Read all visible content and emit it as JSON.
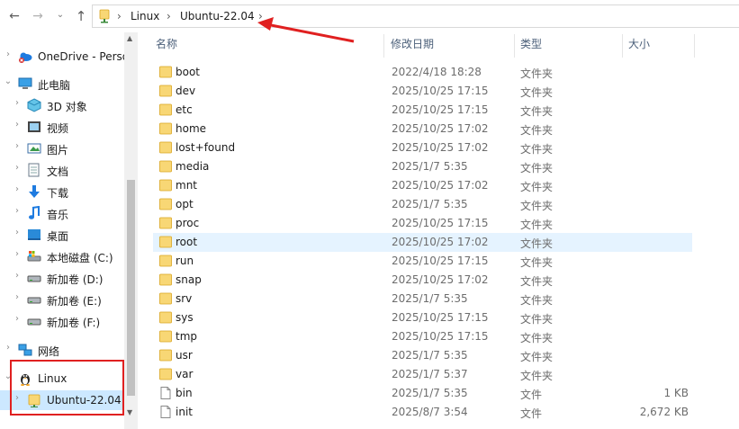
{
  "address_bar": {
    "breadcrumbs": [
      "Linux",
      "Ubuntu-22.04"
    ]
  },
  "nav_pane": {
    "items": [
      {
        "label": "OneDrive - Perso",
        "icon": "onedrive-icon",
        "level": 0,
        "chevron": "right"
      },
      {
        "label": "此电脑",
        "icon": "this-pc-icon",
        "level": 0,
        "chevron": "down"
      },
      {
        "label": "3D 对象",
        "icon": "3d-objects-icon",
        "level": 1,
        "chevron": "right"
      },
      {
        "label": "视频",
        "icon": "videos-icon",
        "level": 1,
        "chevron": "right"
      },
      {
        "label": "图片",
        "icon": "pictures-icon",
        "level": 1,
        "chevron": "right"
      },
      {
        "label": "文档",
        "icon": "documents-icon",
        "level": 1,
        "chevron": "right"
      },
      {
        "label": "下载",
        "icon": "downloads-icon",
        "level": 1,
        "chevron": "right"
      },
      {
        "label": "音乐",
        "icon": "music-icon",
        "level": 1,
        "chevron": "right"
      },
      {
        "label": "桌面",
        "icon": "desktop-icon",
        "level": 1,
        "chevron": "right"
      },
      {
        "label": "本地磁盘 (C:)",
        "icon": "local-disk-icon",
        "level": 1,
        "chevron": "right"
      },
      {
        "label": "新加卷 (D:)",
        "icon": "drive-icon",
        "level": 1,
        "chevron": "right"
      },
      {
        "label": "新加卷 (E:)",
        "icon": "drive-icon",
        "level": 1,
        "chevron": "right"
      },
      {
        "label": "新加卷 (F:)",
        "icon": "drive-icon",
        "level": 1,
        "chevron": "right"
      },
      {
        "label": "网络",
        "icon": "network-icon",
        "level": 0,
        "chevron": "right"
      },
      {
        "label": "Linux",
        "icon": "linux-penguin-icon",
        "level": 0,
        "chevron": "down"
      },
      {
        "label": "Ubuntu-22.04",
        "icon": "folder-icon",
        "level": 1,
        "chevron": "right",
        "selected": true
      }
    ]
  },
  "file_list": {
    "columns": {
      "name": "名称",
      "date": "修改日期",
      "type": "类型",
      "size": "大小"
    },
    "rows": [
      {
        "name": "boot",
        "date": "2022/4/18 18:28",
        "type": "文件夹",
        "size": "",
        "kind": "folder"
      },
      {
        "name": "dev",
        "date": "2025/10/25 17:15",
        "type": "文件夹",
        "size": "",
        "kind": "folder"
      },
      {
        "name": "etc",
        "date": "2025/10/25 17:15",
        "type": "文件夹",
        "size": "",
        "kind": "folder"
      },
      {
        "name": "home",
        "date": "2025/10/25 17:02",
        "type": "文件夹",
        "size": "",
        "kind": "folder"
      },
      {
        "name": "lost+found",
        "date": "2025/10/25 17:02",
        "type": "文件夹",
        "size": "",
        "kind": "folder"
      },
      {
        "name": "media",
        "date": "2025/1/7 5:35",
        "type": "文件夹",
        "size": "",
        "kind": "folder"
      },
      {
        "name": "mnt",
        "date": "2025/10/25 17:02",
        "type": "文件夹",
        "size": "",
        "kind": "folder"
      },
      {
        "name": "opt",
        "date": "2025/1/7 5:35",
        "type": "文件夹",
        "size": "",
        "kind": "folder"
      },
      {
        "name": "proc",
        "date": "2025/10/25 17:15",
        "type": "文件夹",
        "size": "",
        "kind": "folder"
      },
      {
        "name": "root",
        "date": "2025/10/25 17:02",
        "type": "文件夹",
        "size": "",
        "kind": "folder",
        "hover": true
      },
      {
        "name": "run",
        "date": "2025/10/25 17:15",
        "type": "文件夹",
        "size": "",
        "kind": "folder"
      },
      {
        "name": "snap",
        "date": "2025/10/25 17:02",
        "type": "文件夹",
        "size": "",
        "kind": "folder"
      },
      {
        "name": "srv",
        "date": "2025/1/7 5:35",
        "type": "文件夹",
        "size": "",
        "kind": "folder"
      },
      {
        "name": "sys",
        "date": "2025/10/25 17:15",
        "type": "文件夹",
        "size": "",
        "kind": "folder"
      },
      {
        "name": "tmp",
        "date": "2025/10/25 17:15",
        "type": "文件夹",
        "size": "",
        "kind": "folder"
      },
      {
        "name": "usr",
        "date": "2025/1/7 5:35",
        "type": "文件夹",
        "size": "",
        "kind": "folder"
      },
      {
        "name": "var",
        "date": "2025/1/7 5:37",
        "type": "文件夹",
        "size": "",
        "kind": "folder"
      },
      {
        "name": "bin",
        "date": "2025/1/7 5:35",
        "type": "文件",
        "size": "1 KB",
        "kind": "file"
      },
      {
        "name": "init",
        "date": "2025/8/7 3:54",
        "type": "文件",
        "size": "2,672 KB",
        "kind": "file"
      }
    ]
  },
  "colors": {
    "accent_select": "#cce8ff",
    "hover_row": "#e5f3ff",
    "folder_yellow": "#f8d775",
    "annotation_red": "#e02020"
  }
}
